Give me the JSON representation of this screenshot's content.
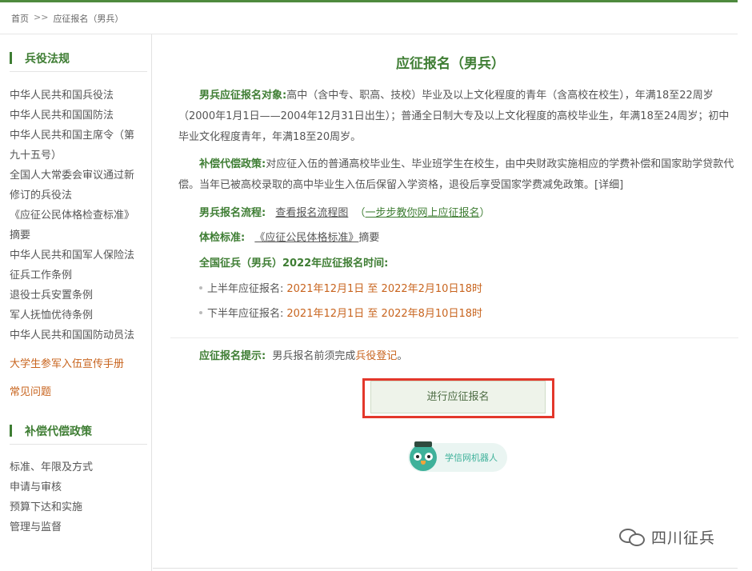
{
  "breadcrumb": {
    "home": "首页",
    "sep": ">>",
    "current": "应征报名（男兵）"
  },
  "sidebar": {
    "section1_title": "兵役法规",
    "section1_links": [
      "中华人民共和国兵役法",
      "中华人民共和国国防法",
      "中华人民共和国主席令（第",
      "九十五号）",
      "全国人大常委会审议通过新",
      "修订的兵役法",
      "《应征公民体格检查标准》",
      "摘要",
      "中华人民共和国军人保险法",
      "征兵工作条例",
      "退役士兵安置条例",
      "军人抚恤优待条例",
      "中华人民共和国国防动员法"
    ],
    "handbook_link": "大学生参军入伍宣传手册",
    "faq_link": "常见问题",
    "section2_title": "补偿代偿政策",
    "section2_links": [
      "标准、年限及方式",
      "申请与审核",
      "预算下达和实施",
      "管理与监督"
    ]
  },
  "main": {
    "title": "应征报名（男兵）",
    "target_label": "男兵应征报名对象:",
    "target_text": "高中（含中专、职高、技校）毕业及以上文化程度的青年（含高校在校生），年满18至22周岁（2000年1月1日——2004年12月31日出生）；普通全日制大专及以上文化程度的高校毕业生，年满18至24周岁；初中毕业文化程度青年，年满18至20周岁。",
    "policy_label": "补偿代偿政策:",
    "policy_text": "对应征入伍的普通高校毕业生、毕业班学生在校生，由中央财政实施相应的学费补偿和国家助学贷款代偿。当年已被高校录取的高中毕业生入伍后保留入学资格，退役后享受国家学费减免政策。",
    "policy_detail": "[详细]",
    "process_label": "男兵报名流程:",
    "process_link": "查看报名流程图",
    "process_paren_open": "（",
    "process_link2": "一步步教你网上应征报名",
    "process_paren_close": "）",
    "exam_label": "体检标准:",
    "exam_link": "《应征公民体格标准》",
    "exam_suffix": "摘要",
    "schedule_title": "全国征兵（男兵）2022年应征报名时间:",
    "h1_label": "上半年应征报名:",
    "h1_dates": "2021年12月1日 至 2022年2月10日18时",
    "h2_label": "下半年应征报名:",
    "h2_dates": "2021年12月1日 至 2022年8月10日18时",
    "tip_label": "应征报名提示:",
    "tip_text": "男兵报名前须完成",
    "tip_link": "兵役登记",
    "tip_end": "。",
    "apply_button": "进行应征报名",
    "robot_label": "学信网机器人"
  },
  "watermark": "四川征兵",
  "colors": {
    "accent_green": "#3e7d33",
    "orange": "#c8641e",
    "highlight_red": "#e3372b"
  }
}
